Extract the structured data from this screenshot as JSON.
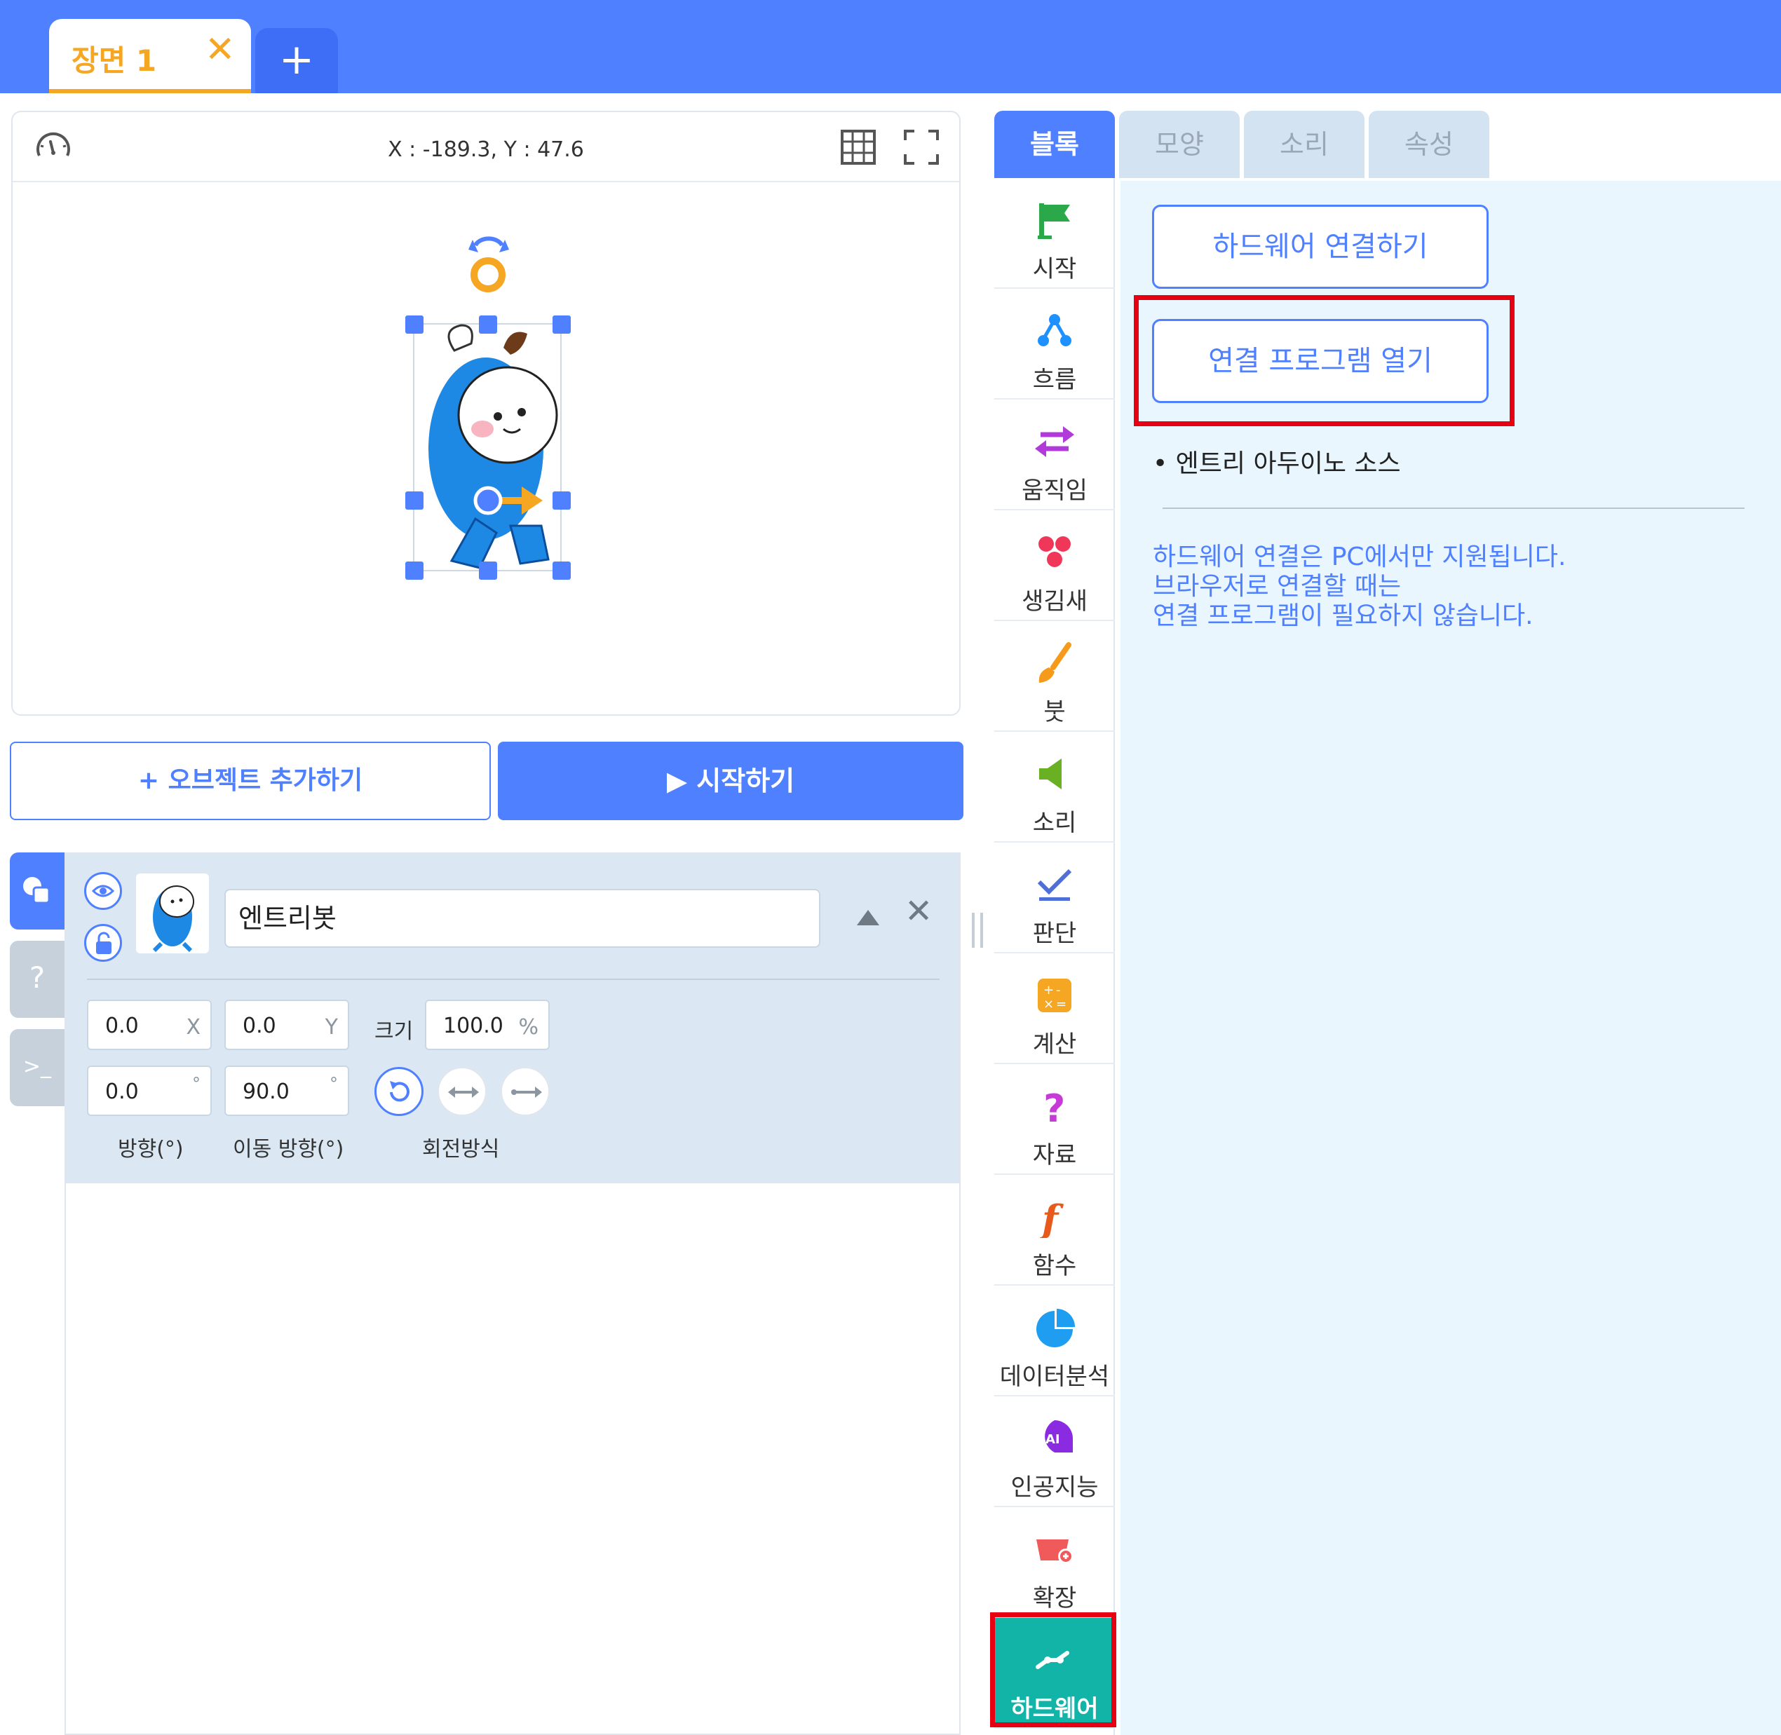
{
  "scene": {
    "tab_label": "장면 1",
    "close_glyph": "✕",
    "add_glyph": "+"
  },
  "stage": {
    "coords": "X : -189.3, Y : 47.6"
  },
  "actions": {
    "add_object": "+ 오브젝트 추가하기",
    "start": "▶ 시작하기"
  },
  "object": {
    "name": "엔트리봇",
    "x": "0.0",
    "x_unit": "X",
    "y": "0.0",
    "y_unit": "Y",
    "size_label": "크기",
    "size": "100.0",
    "size_unit": "%",
    "direction": "0.0",
    "move_direction": "90.0",
    "deg_unit": "°",
    "direction_label": "방향(°)",
    "move_direction_label": "이동 방향(°)",
    "rotation_label": "회전방식"
  },
  "side_tabs": {
    "help_glyph": "?",
    "terminal_glyph": ">_"
  },
  "tabs": [
    "블록",
    "모양",
    "소리",
    "속성"
  ],
  "categories": [
    "시작",
    "흐름",
    "움직임",
    "생김새",
    "붓",
    "소리",
    "판단",
    "계산",
    "자료",
    "함수",
    "데이터분석",
    "인공지능",
    "확장",
    "하드웨어"
  ],
  "hardware": {
    "connect_button": "하드웨어 연결하기",
    "open_program_button": "연결 프로그램 열기",
    "source_item": "•  엔트리 아두이노 소스",
    "notice": [
      "하드웨어 연결은 PC에서만 지원됩니다.",
      "브라우저로 연결할 때는",
      "연결 프로그램이 필요하지 않습니다."
    ]
  },
  "colors": {
    "primary": "#4f80ff",
    "accent": "#f5a623",
    "hardware": "#12b4a8",
    "highlight": "#e60012"
  }
}
